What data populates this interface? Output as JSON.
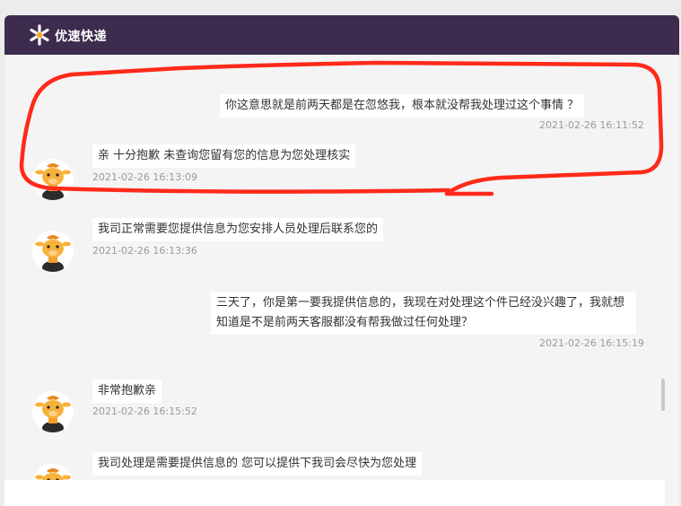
{
  "header": {
    "brand": "优速快递"
  },
  "messages": [
    {
      "side": "right",
      "text": "你这意思就是前两天都是在忽悠我，根本就没帮我处理过这个事情 ？",
      "time": "2021-02-26 16:11:52"
    },
    {
      "side": "left",
      "text": "亲 十分抱歉 未查询您留有您的信息为您处理核实",
      "time": "2021-02-26 16:13:09"
    },
    {
      "side": "left",
      "text": "我司正常需要您提供信息为您安排人员处理后联系您的",
      "time": "2021-02-26 16:13:36"
    },
    {
      "side": "right",
      "text": "三天了，你是第一要我提供信息的，我现在对处理这个件已经没兴趣了，我就想知道是不是前两天客服都没有帮我做过任何处理？",
      "time": "2021-02-26 16:15:19"
    },
    {
      "side": "left",
      "text": "非常抱歉亲",
      "time": "2021-02-26 16:15:52"
    },
    {
      "side": "left",
      "text": "我司处理是需要提供信息的 您可以提供下我司会尽快为您处理",
      "time": ""
    }
  ],
  "colors": {
    "header": "#3d2c4e",
    "annotation": "#ff2a1a",
    "logo": "#f7a21b"
  }
}
